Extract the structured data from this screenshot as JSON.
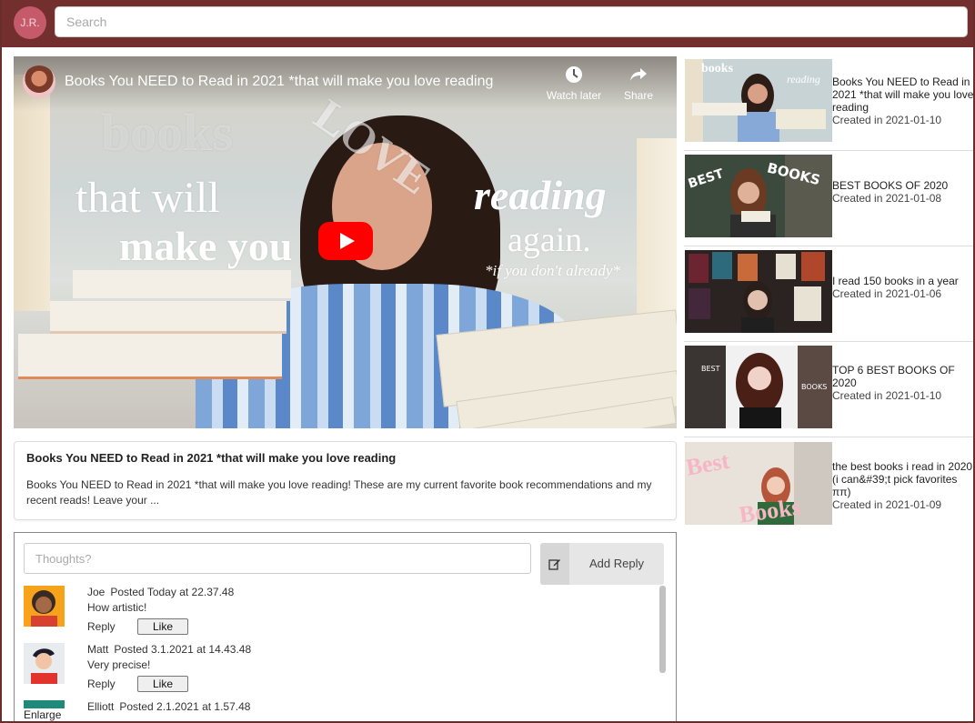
{
  "user": {
    "initials": "J.R."
  },
  "search": {
    "placeholder": "Search"
  },
  "video": {
    "title": "Books You NEED to Read in 2021 *that will make you love reading",
    "watch_later": "Watch later",
    "share": "Share",
    "overlay": {
      "books": "books",
      "that_will": "that will",
      "make_you": "make you",
      "love": "LOVE",
      "reading": "reading",
      "again": "again.",
      "if_you": "*if you don't already*"
    },
    "description": "Books You NEED to Read in 2021 *that will make you love reading! These are my current favorite book recommendations and my recent reads! Leave your ..."
  },
  "comments": {
    "placeholder": "Thoughts?",
    "add_reply": "Add Reply",
    "reply_label": "Reply",
    "like_label": "Like",
    "enlarge": "Enlarge",
    "items": [
      {
        "author": "Joe",
        "posted": "Posted Today at 22.37.48",
        "text": "How artistic!"
      },
      {
        "author": "Matt",
        "posted": "Posted 3.1.2021 at 14.43.48",
        "text": "Very precise!"
      },
      {
        "author": "Elliott",
        "posted": "Posted 2.1.2021 at 1.57.48",
        "text": ""
      }
    ]
  },
  "related": [
    {
      "title": "Books You NEED to Read in 2021 *that will make you love reading",
      "date": "Created in 2021-01-10"
    },
    {
      "title": "BEST BOOKS OF 2020",
      "date": "Created in 2021-01-08"
    },
    {
      "title": "I read 150 books in a year",
      "date": "Created in 2021-01-06"
    },
    {
      "title": "TOP 6 BEST BOOKS OF 2020",
      "date": "Created in 2021-01-10"
    },
    {
      "title": "the best books i read in 2020 (i can&#39;t pick favorites ππ)",
      "date": "Created in 2021-01-09"
    }
  ],
  "colors": {
    "topbar": "#732e2e",
    "avatar": "#c45a6a",
    "youtube_red": "#ff0000"
  }
}
